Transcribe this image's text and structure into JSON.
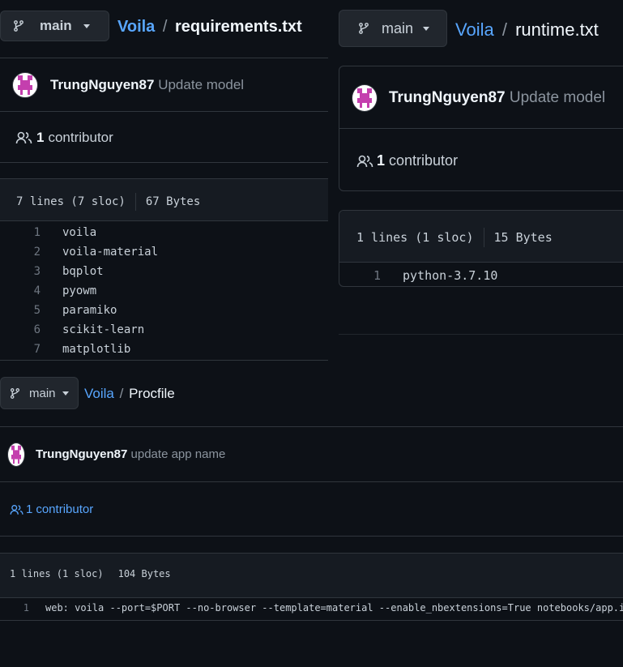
{
  "files": [
    {
      "branch": "main",
      "repo": "Voila",
      "separator": "/",
      "filename": "requirements.txt",
      "author": "TrungNguyen87",
      "commit_message": "Update model",
      "contributors_count": "1",
      "contributors_label": "contributor",
      "lines_info": "7 lines (7 sloc)",
      "size": "67 Bytes",
      "lines": [
        {
          "num": "1",
          "text": "voila"
        },
        {
          "num": "2",
          "text": "voila-material"
        },
        {
          "num": "3",
          "text": "bqplot"
        },
        {
          "num": "4",
          "text": "pyowm"
        },
        {
          "num": "5",
          "text": "paramiko"
        },
        {
          "num": "6",
          "text": "scikit-learn"
        },
        {
          "num": "7",
          "text": "matplotlib"
        }
      ]
    },
    {
      "branch": "main",
      "repo": "Voila",
      "separator": "/",
      "filename": "runtime.txt",
      "author": "TrungNguyen87",
      "commit_message": "Update model",
      "contributors_count": "1",
      "contributors_label": "contributor",
      "lines_info": "1 lines (1 sloc)",
      "size": "15 Bytes",
      "lines": [
        {
          "num": "1",
          "text": "python-3.7.10"
        }
      ]
    },
    {
      "branch": "main",
      "repo": "Voila",
      "separator": "/",
      "filename": "Procfile",
      "author": "TrungNguyen87",
      "commit_message": "update app name",
      "contributors_count": "1",
      "contributors_label": "contributor",
      "lines_info": "1 lines (1 sloc)",
      "size": "104 Bytes",
      "lines": [
        {
          "num": "1",
          "text": "web: voila --port=$PORT --no-browser --template=material --enable_nbextensions=True notebooks/app.ipynb"
        }
      ]
    }
  ],
  "colors": {
    "background": "#0d1117",
    "border": "#30363d",
    "link": "#58a6ff",
    "muted": "#8b949e",
    "avatar_accent": "#c43fae"
  }
}
